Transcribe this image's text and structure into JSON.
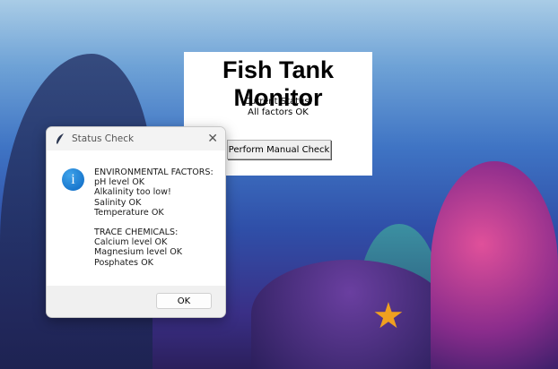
{
  "main_window": {
    "title": "Fish Tank Monitor",
    "status_label": "Current Status:",
    "status_value": "All factors OK",
    "check_button": "Perform Manual Check"
  },
  "dialog": {
    "title": "Status Check",
    "icon": "info-icon",
    "env_header": "ENVIRONMENTAL FACTORS:",
    "env_items": [
      "pH level OK",
      "Alkalinity too low!",
      "Salinity OK",
      "Temperature OK"
    ],
    "trace_header": "TRACE CHEMICALS:",
    "trace_items": [
      "Calcium level OK",
      "Magnesium level OK",
      "Posphates OK"
    ],
    "ok_button": "OK"
  }
}
